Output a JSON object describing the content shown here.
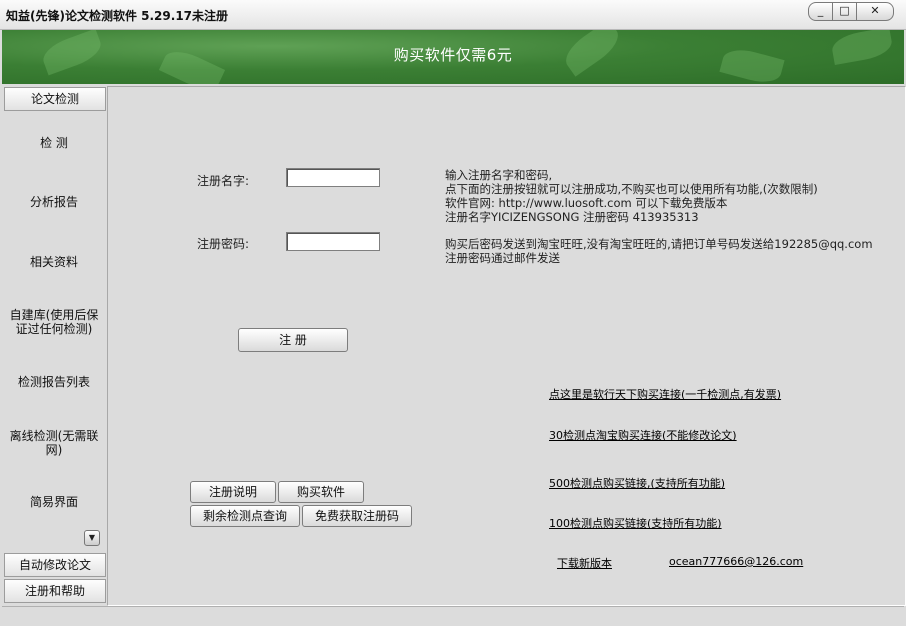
{
  "window": {
    "title": "知益(先锋)论文检测软件 5.29.17未注册",
    "minimize": "_",
    "maximize": "□",
    "close": "✕"
  },
  "banner": {
    "text": "购买软件仅需6元",
    "color": "#3b7f34"
  },
  "sidebar": {
    "top_button": "论文检测",
    "items": [
      "检 测",
      "分析报告",
      "相关资料",
      "自建库(使用后保证过任何检测)",
      "检测报告列表",
      "离线检测(无需联网)",
      "简易界面"
    ],
    "bottom_buttons": [
      "自动修改论文",
      "注册和帮助"
    ],
    "scroll_icon": "▼"
  },
  "form": {
    "name_label": "注册名字:",
    "name_value": "",
    "password_label": "注册密码:",
    "password_value": "",
    "register_button": "注 册"
  },
  "info": {
    "lines1": [
      "输入注册名字和密码,",
      "点下面的注册按钮就可以注册成功,不购买也可以使用所有功能,(次数限制)",
      "软件官网: http://www.luosoft.com 可以下载免费版本",
      "注册名字YICIZENGSONG 注册密码 413935313"
    ],
    "lines2": [
      "购买后密码发送到淘宝旺旺,没有淘宝旺旺的,请把订单号码发送给192285@qq.com",
      "注册密码通过邮件发送"
    ]
  },
  "buttons": {
    "reg_help": "注册说明",
    "buy": "购买软件",
    "remaining": "剩余检测点查询",
    "free_code": "免费获取注册码"
  },
  "links": {
    "l1": "点这里是软行天下购买连接(一千检测点,有发票)",
    "l2": "30检测点淘宝购买连接(不能修改论文)",
    "l3": "500检测点购买链接,(支持所有功能)",
    "l4": "100检测点购买链接(支持所有功能)",
    "download": "下载新版本",
    "email": "ocean777666@126.com"
  }
}
